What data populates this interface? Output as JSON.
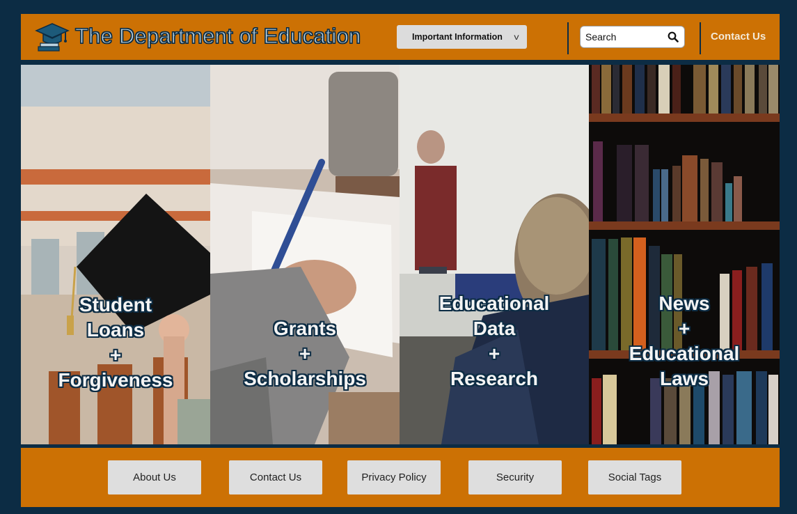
{
  "header": {
    "title": "The Department of Education",
    "dropdown_label": "Important Information",
    "dropdown_chevron": "v",
    "search_placeholder": "Search",
    "contact_label": "Contact Us"
  },
  "panels": [
    {
      "lines": [
        "Student",
        "Loans",
        "+",
        "Forgiveness"
      ],
      "image": "graduation-cap-photo"
    },
    {
      "lines": [
        "Grants",
        "+",
        "Scholarships"
      ],
      "image": "writing-hand-photo"
    },
    {
      "lines": [
        "Educational",
        "Data",
        "+",
        "Research"
      ],
      "image": "classroom-photo"
    },
    {
      "lines": [
        "News",
        "+",
        "Educational",
        "Laws"
      ],
      "image": "bookshelf-photo"
    }
  ],
  "footer": {
    "buttons": [
      "About Us",
      "Contact Us",
      "Privacy Policy",
      "Security",
      "Social Tags"
    ]
  },
  "colors": {
    "background": "#0c2c44",
    "accent": "#cc7104",
    "button": "#dedede"
  }
}
